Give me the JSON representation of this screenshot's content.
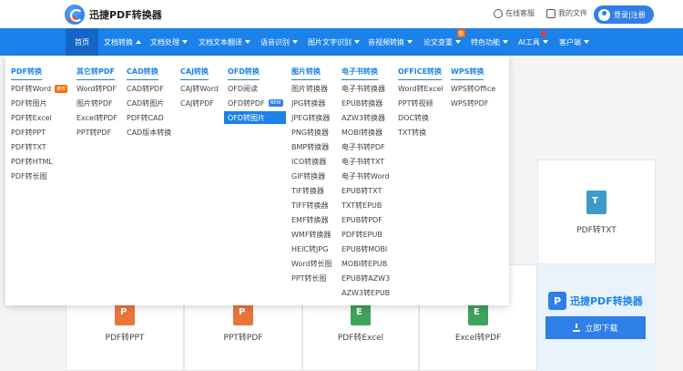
{
  "header": {
    "app_name": "迅捷PDF转换器",
    "service_label": "在线客服",
    "files_label": "我的文件",
    "login_label": "登录|注册"
  },
  "nav": {
    "items": [
      {
        "label": "首页",
        "caret": "none"
      },
      {
        "label": "文档转换",
        "caret": "up"
      },
      {
        "label": "文档处理",
        "caret": "down"
      },
      {
        "label": "文档文本翻译",
        "caret": "down"
      },
      {
        "label": "语音识别",
        "caret": "down"
      },
      {
        "label": "图片文字识别",
        "caret": "down"
      },
      {
        "label": "音视频转换",
        "caret": "down"
      },
      {
        "label": "论文查重",
        "caret": "down"
      },
      {
        "label": "特色功能",
        "caret": "down"
      },
      {
        "label": "AI工具",
        "caret": "down"
      },
      {
        "label": "客户端",
        "caret": "down"
      }
    ],
    "new_badge": "新"
  },
  "menu": {
    "columns": [
      {
        "title": "PDF转换",
        "items": [
          "PDF转Word",
          "PDF转图片",
          "PDF转Excel",
          "PDF转PPT",
          "PDF转TXT",
          "PDF转HTML",
          "PDF转长图"
        ]
      },
      {
        "title": "其它转PDF",
        "items": [
          "Word转PDF",
          "图片转PDF",
          "Excel转PDF",
          "PPT转PDF"
        ]
      },
      {
        "title": "CAD转换",
        "items": [
          "CAD转PDF",
          "CAD转图片",
          "PDF转CAD",
          "CAD版本转换"
        ]
      },
      {
        "title": "CAJ转换",
        "items": [
          "CAJ转Word",
          "CAJ转PDF"
        ]
      },
      {
        "title": "OFD转换",
        "items": [
          "OFD阅读",
          "OFD转PDF",
          "OFD转图片"
        ]
      },
      {
        "title": "图片转换",
        "items": [
          "图片转换器",
          "JPG转换器",
          "JPEG转换器",
          "PNG转换器",
          "BMP转换器",
          "ICO转换器",
          "GIF转换器",
          "TIF转换器",
          "TIFF转换器",
          "EMF转换器",
          "WMF转换器",
          "HEIC转JPG",
          "Word转长图",
          "PPT转长图"
        ]
      },
      {
        "title": "电子书转换",
        "items": [
          "电子书转换器",
          "EPUB转换器",
          "AZW3转换器",
          "MOBI转换器",
          "电子书转PDF",
          "电子书转TXT",
          "电子书转Word",
          "EPUB转TXT",
          "TXT转EPUB",
          "EPUB转PDF",
          "PDF转EPUB",
          "EPUB转MOBI",
          "MOBI转EPUB",
          "EPUB转AZW3",
          "AZW3转EPUB"
        ]
      },
      {
        "title": "OFFICE转换",
        "items": [
          "Word转Excel",
          "PPT转视频",
          "DOC转换",
          "TXT转换"
        ]
      },
      {
        "title": "WPS转换",
        "items": [
          "WPS转Office",
          "WPS转PDF"
        ]
      }
    ],
    "tags": {
      "hot": "推荐",
      "new": "NEW"
    },
    "selected": "OFD转图片"
  },
  "cards": {
    "pdf_txt": "PDF转TXT",
    "pdf_ppt": "PDF转PPT",
    "ppt_pdf": "PPT转PDF",
    "pdf_excel": "PDF转Excel",
    "excel_pdf": "Excel转PDF",
    "txt_icon_letter": "T",
    "ppt_icon_letter": "P",
    "excel_icon_letter": "E"
  },
  "promo": {
    "brand": "迅捷PDF转换器",
    "mark": "P",
    "download_label": "立即下载"
  },
  "colors": {
    "primary": "#1c82ea",
    "active_nav": "#1566c6",
    "accent_orange": "#ff6a00",
    "ai_arrow": "#e63a2e"
  }
}
